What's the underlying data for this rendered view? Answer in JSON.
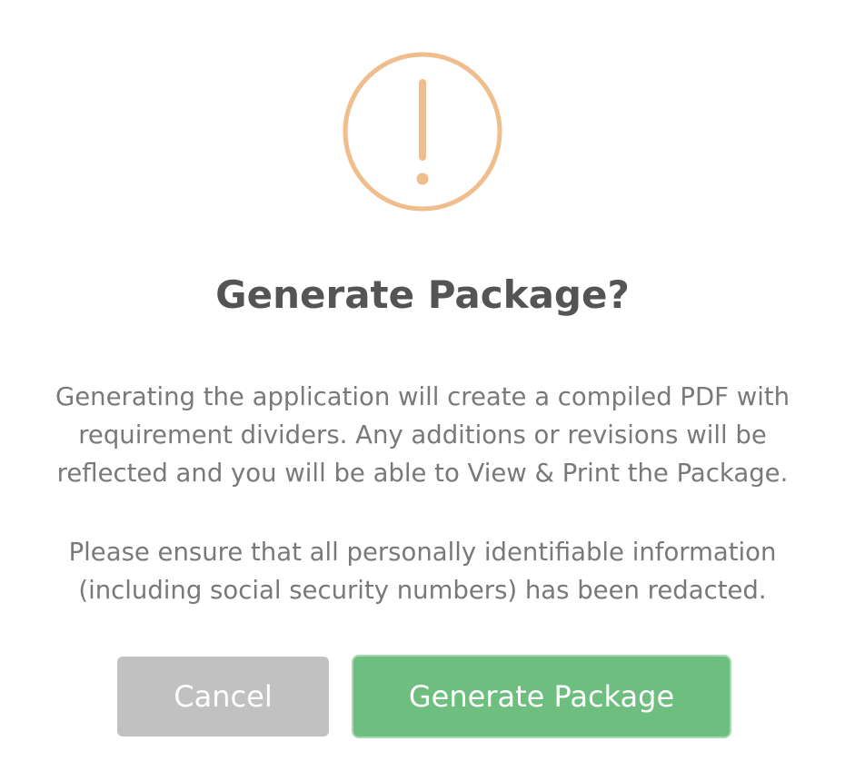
{
  "dialog": {
    "icon": "warning-exclamation-icon",
    "icon_color": "#f0bd8d",
    "title": "Generate Package?",
    "paragraph_1": "Generating the application will create a compiled PDF with requirement dividers. Any additions or revisions will be reflected and you will be able to View & Print the Package.",
    "paragraph_2": "Please ensure that all personally identifiable information (including social security numbers) has been redacted.",
    "cancel_label": "Cancel",
    "confirm_label": "Generate Package",
    "cancel_color": "#c1c1c1",
    "confirm_color": "#6ebf7f"
  }
}
